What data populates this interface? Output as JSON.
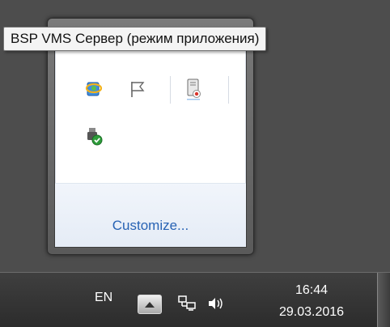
{
  "tooltip": {
    "text": "BSP VMS Сервер (режим приложения)"
  },
  "flyout": {
    "icons": [
      {
        "name": "network-app-icon"
      },
      {
        "name": "action-center-flag-icon"
      },
      {
        "name": "bsp-vms-server-icon",
        "selected": true
      },
      {
        "name": "usb-safely-remove-icon"
      }
    ],
    "customize_label": "Customize..."
  },
  "taskbar": {
    "language": "EN",
    "show_hidden_icon": "triangle-up-icon",
    "network_icon": "network-icon",
    "volume_icon": "volume-icon",
    "time": "16:44",
    "date": "29.03.2016"
  },
  "colors": {
    "link": "#2863b4",
    "taskbar": "#353535",
    "flyout_frame": "#6a6a6a"
  }
}
